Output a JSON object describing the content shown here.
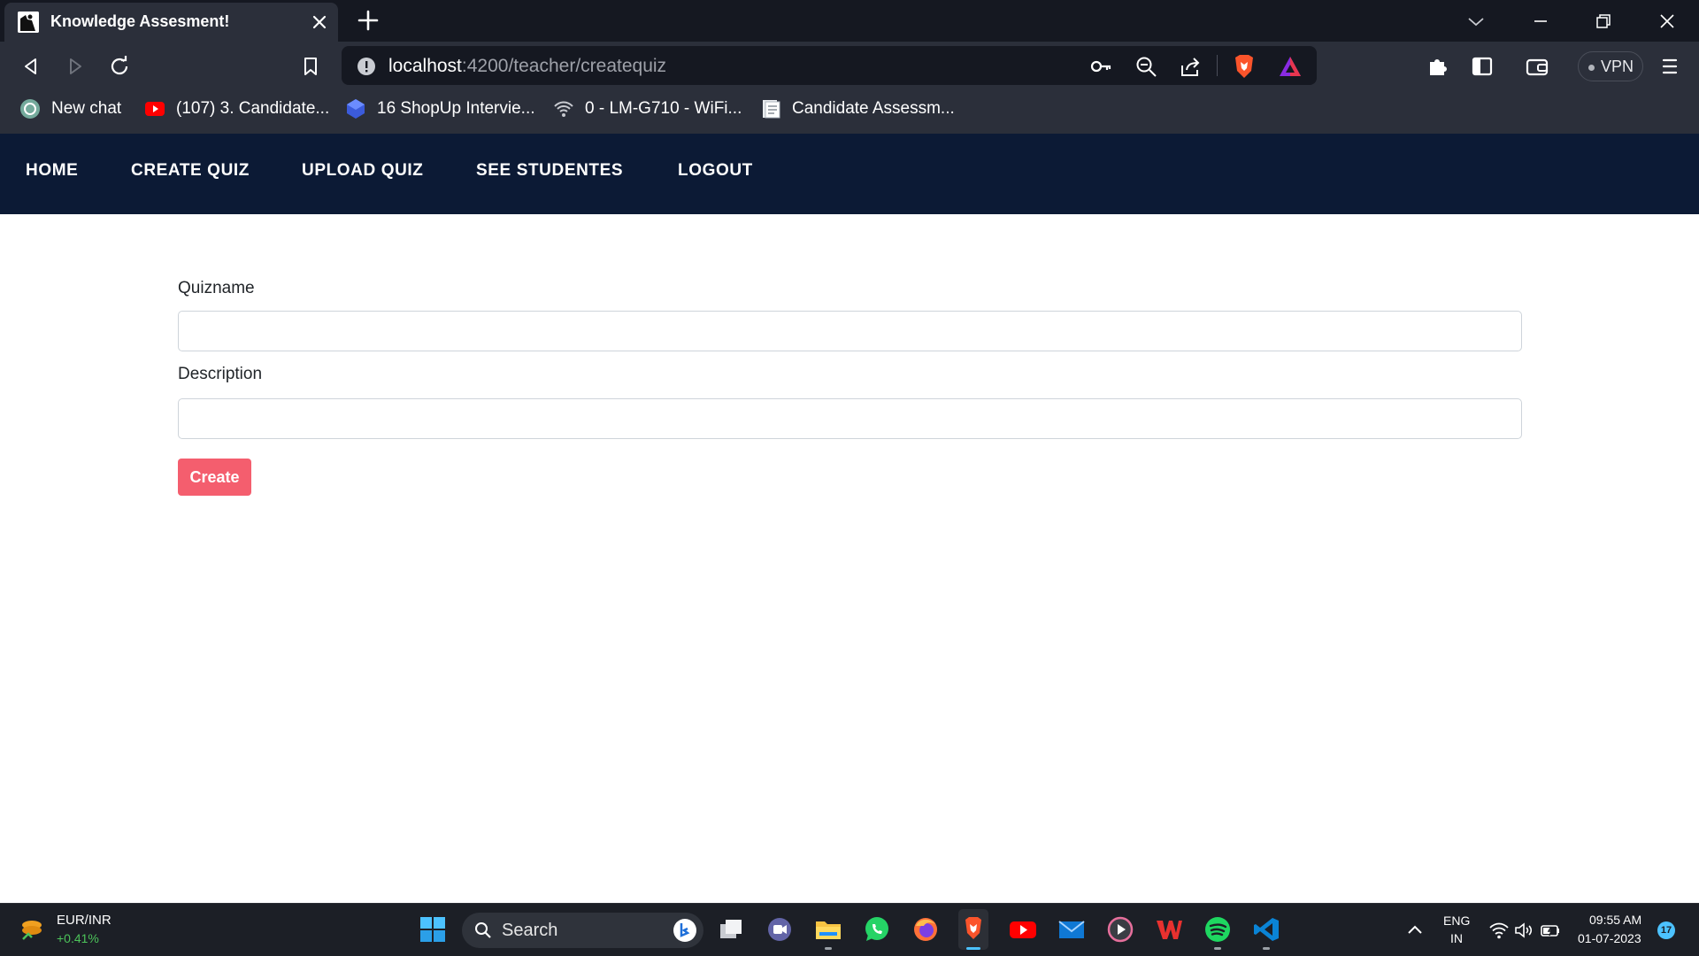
{
  "browser": {
    "tab_title": "Knowledge Assesment!",
    "url_host": "localhost",
    "url_path": ":4200/teacher/createquiz",
    "vpn_label": "VPN",
    "bookmarks": [
      {
        "label": "New chat",
        "icon": "openai-icon"
      },
      {
        "label": "(107) 3. Candidate...",
        "icon": "youtube-icon"
      },
      {
        "label": "16 ShopUp Intervie...",
        "icon": "cube-icon"
      },
      {
        "label": "0 - LM-G710 - WiFi...",
        "icon": "wifi-icon"
      },
      {
        "label": "Candidate Assessm...",
        "icon": "document-icon"
      }
    ]
  },
  "navbar": {
    "links": [
      "HOME",
      "CREATE QUIZ",
      "UPLOAD QUIZ",
      "SEE STUDENTES",
      "LOGOUT"
    ]
  },
  "form": {
    "quizname_label": "Quizname",
    "quizname_value": "",
    "description_label": "Description",
    "description_value": "",
    "create_label": "Create"
  },
  "taskbar": {
    "ticker_symbol": "EUR/INR",
    "ticker_change": "+0.41%",
    "search_label": "Search",
    "lang_primary": "ENG",
    "lang_secondary": "IN",
    "time": "09:55 AM",
    "date": "01-07-2023",
    "notification_count": "17"
  },
  "colors": {
    "navbar_bg": "#0c1a35",
    "create_button": "#f45e6e",
    "ticker_positive": "#4cc35a"
  }
}
